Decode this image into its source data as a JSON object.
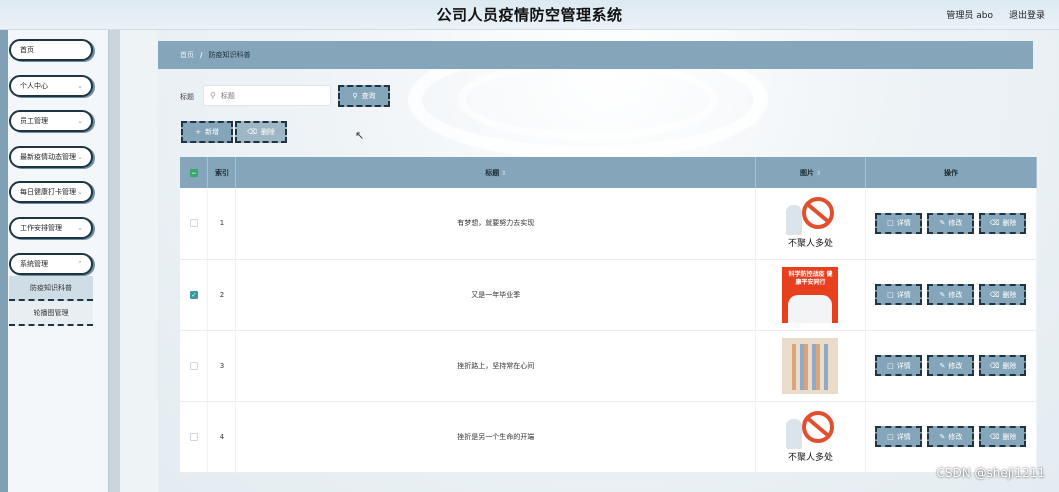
{
  "app": {
    "title": "公司人员疫情防空管理系统",
    "user_label": "管理员 abo",
    "logout_label": "退出登录"
  },
  "sidebar": {
    "items": [
      {
        "label": "首页",
        "has_chevron": false
      },
      {
        "label": "个人中心",
        "has_chevron": true
      },
      {
        "label": "员工管理",
        "has_chevron": true
      },
      {
        "label": "最新疫情动态管理",
        "has_chevron": true
      },
      {
        "label": "每日健康打卡管理",
        "has_chevron": true
      },
      {
        "label": "工作安排管理",
        "has_chevron": true
      },
      {
        "label": "系统管理",
        "has_chevron": true
      }
    ],
    "submenu": [
      {
        "label": "防疫知识科普",
        "active": true
      },
      {
        "label": "轮播图管理",
        "active": false
      }
    ]
  },
  "breadcrumb": {
    "home": "首页",
    "separator": "/",
    "current": "防疫知识科普"
  },
  "search": {
    "label": "标题",
    "placeholder": "标题",
    "value": "",
    "query_button": "查询"
  },
  "toolbar": {
    "add_label": "新增",
    "delete_label": "删除"
  },
  "table": {
    "headers": {
      "index": "索引",
      "title": "标题",
      "image": "图片",
      "actions": "操作"
    },
    "rows": [
      {
        "index": "1",
        "title": "有梦想，就要努力去实现",
        "checked": false,
        "image_type": "no-gathering-poster",
        "image_text": "不聚人多处"
      },
      {
        "index": "2",
        "title": "又是一年毕业季",
        "checked": true,
        "image_type": "epidemic-poster",
        "image_text": "科学防控战疫 健康平安同行"
      },
      {
        "index": "3",
        "title": "挫折路上，坚持常在心间",
        "checked": false,
        "image_type": "drawing-poster",
        "image_text": ""
      },
      {
        "index": "4",
        "title": "挫折是另一个生命的开端",
        "checked": false,
        "image_type": "no-gathering-poster",
        "image_text": "不聚人多处"
      }
    ],
    "row_actions": {
      "detail": "详情",
      "edit": "修改",
      "delete": "删除"
    }
  },
  "watermark": "CSDN @sheji1211",
  "colors": {
    "accent": "#84a5ba",
    "border_dark": "#1f3442",
    "checked": "#3a9aa0"
  }
}
